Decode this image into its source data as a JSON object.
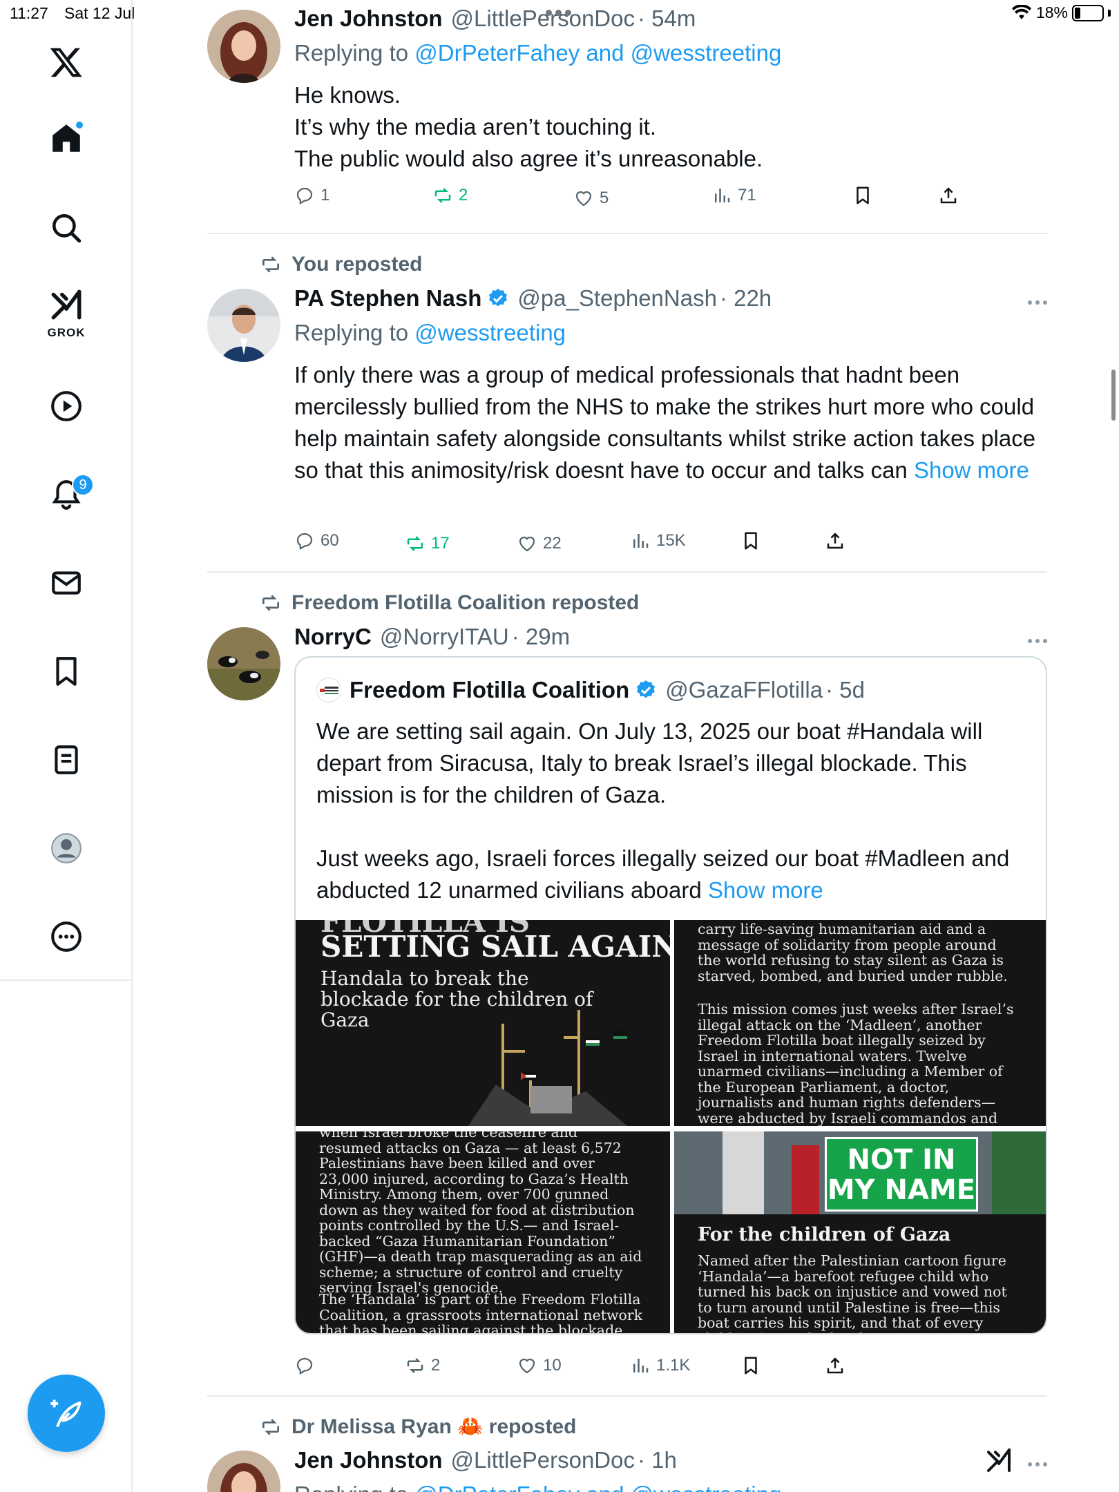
{
  "status_bar": {
    "time": "11:27",
    "date": "Sat 12 Jul",
    "battery": "18%"
  },
  "sidebar": {
    "grok_label": "GROK",
    "notifications_badge": "9"
  },
  "posts": [
    {
      "author": "Jen Johnston",
      "handle": "@LittlePersonDoc",
      "time": "· 54m",
      "replying_label": "Replying to",
      "replying_targets": "@DrPeterFahey and @wesstreeting",
      "body": [
        "He knows.",
        "It’s why the media aren’t touching it.",
        "The public would also agree it’s unreasonable."
      ],
      "replies": "1",
      "reposts": "2",
      "likes": "5",
      "views": "71"
    },
    {
      "repost_label": "You reposted",
      "author": "PA Stephen Nash",
      "handle": "@pa_StephenNash",
      "time": "· 22h",
      "replying_label": "Replying to",
      "replying_targets": "@wesstreeting",
      "body_text": "If only there was a group of medical professionals that hadnt been mercilessly bullied from the NHS to make the strikes hurt more who could help maintain safety alongside consultants whilst strike action takes place so that this animosity/risk doesnt have to occur and talks can",
      "show_more": "Show more",
      "replies": "60",
      "reposts": "17",
      "likes": "22",
      "views": "15K"
    },
    {
      "repost_label": "Freedom Flotilla Coalition reposted",
      "author": "NorryC",
      "handle": "@NorryITAU",
      "time": "· 29m",
      "quote": {
        "author": "Freedom Flotilla Coalition",
        "handle": "@GazaFFlotilla",
        "time": "· 5d",
        "body_text": "We are setting sail again. On July 13, 2025 our boat #Handala will depart from Siracusa, Italy to break Israel’s illegal blockade. This mission is for the children of Gaza.\n\nJust weeks ago, Israeli forces illegally seized our boat #Madleen and abducted 12 unarmed civilians aboard",
        "show_more": "Show more",
        "tile1": {
          "headline_top": "FLOTILLA IS",
          "headline": "SETTING SAIL AGAIN",
          "subline": "Handala to break the blockade for the children of Gaza"
        },
        "tile2": {
          "text": "carry life-saving humanitarian aid and a message of solidarity from people around the world refusing to stay silent as Gaza is starved, bombed, and buried under rubble.",
          "text2": "This mission comes just weeks after Israel’s illegal attack on the ‘Madleen’, another Freedom Flotilla boat illegally seized by Israel in international waters. Twelve unarmed civilians—including a Member of the European Parliament, a doctor, journalists and human rights defenders—were abducted by Israeli commandos and taken against their will to Israel,"
        },
        "tile3": {
          "text": "when Israel broke the ceasefire and resumed attacks on Gaza — at least 6,572 Palestinians have been killed and over 23,000 injured, according to Gaza’s Health Ministry. Among them, over 700 gunned down as they waited for food at distribution points controlled by the U.S.— and Israel-backed “Gaza Humanitarian Foundation” (GHF)—a death trap masquerading as an aid scheme; a structure of control and cruelty serving Israel's genocide.",
          "text2": "The ‘Handala’ is part of the Freedom Flotilla Coalition, a grassroots international network that has been sailing against the blockade since"
        },
        "tile4": {
          "sign": "NOT IN MY NAME",
          "heading": "For the children of Gaza",
          "text": "Named after the Palestinian cartoon figure ‘Handala’—a barefoot refugee child who turned his back on injustice and vowed not to turn around until Palestine is free—this boat carries his spirit, and that of every child in Gaza who has been"
        }
      },
      "replies": "",
      "reposts": "2",
      "likes": "10",
      "views": "1.1K"
    },
    {
      "repost_label": "Dr Melissa Ryan 🦀 reposted",
      "author": "Jen Johnston",
      "handle": "@LittlePersonDoc",
      "time": "· 1h",
      "replying_label": "Replying to",
      "replying_targets": "@DrPeterFahey and @wesstreeting"
    }
  ],
  "colors": {
    "accent": "#1d9bf0",
    "repost_green": "#00ba7c",
    "muted": "#536471"
  }
}
